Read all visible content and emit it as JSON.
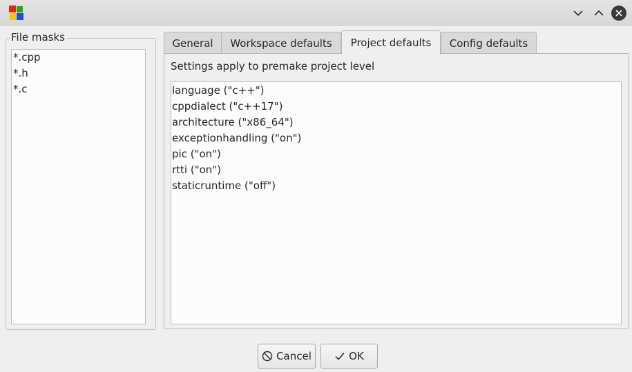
{
  "window": {
    "app_icon": "colored-blocks-icon",
    "controls": [
      "minimize-icon",
      "maximize-icon",
      "close-icon"
    ]
  },
  "file_masks": {
    "title": "File masks",
    "items": [
      "*.cpp",
      "*.h",
      "*.c"
    ]
  },
  "tabs": [
    {
      "label": "General",
      "active": false
    },
    {
      "label": "Workspace defaults",
      "active": false
    },
    {
      "label": "Project defaults",
      "active": true
    },
    {
      "label": "Config defaults",
      "active": false
    }
  ],
  "panel": {
    "caption": "Settings apply to premake project level",
    "lines": [
      "language (\"c++\")",
      "cppdialect (\"c++17\")",
      "architecture (\"x86_64\")",
      "exceptionhandling (\"on\")",
      "pic (\"on\")",
      "rtti (\"on\")",
      "staticruntime (\"off\")"
    ]
  },
  "buttons": {
    "cancel_label": "Cancel",
    "cancel_icon": "cancel-icon",
    "ok_label": "OK",
    "ok_icon": "checkmark-icon"
  }
}
